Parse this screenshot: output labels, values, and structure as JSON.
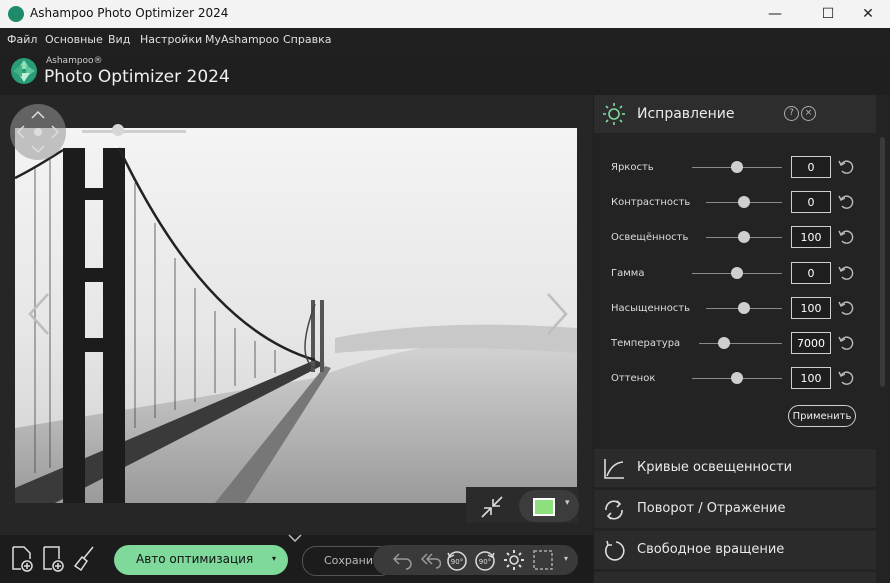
{
  "window": {
    "title": "Ashampoo Photo Optimizer 2024",
    "min": "—",
    "max": "☐",
    "close": "✕"
  },
  "menu": [
    "Файл",
    "Основные",
    "Вид",
    "Настройки",
    "MyAshampoo",
    "Справка"
  ],
  "brand": {
    "small": "Ashampoo®",
    "name": "Photo Optimizer 2024"
  },
  "panel": {
    "title": "Исправление",
    "help": "?",
    "close": "×",
    "sliders": [
      {
        "label": "Яркость",
        "value": "0",
        "level": 0.5
      },
      {
        "label": "Контрастность",
        "value": "0",
        "level": 0.5
      },
      {
        "label": "Освещённость",
        "value": "100",
        "level": 0.5
      },
      {
        "label": "Гамма",
        "value": "0",
        "level": 0.5
      },
      {
        "label": "Насыщенность",
        "value": "100",
        "level": 0.5
      },
      {
        "label": "Температура",
        "value": "7000",
        "level": 0.3
      },
      {
        "label": "Оттенок",
        "value": "100",
        "level": 0.5
      }
    ],
    "apply": "Применить",
    "sections": [
      "Кривые освещенности",
      "Поворот / Отражение",
      "Свободное вращение"
    ]
  },
  "toolbar": {
    "auto": "Авто оптимизация",
    "save": "Сохранить",
    "dropdown": "▾",
    "accent": "#7ed99b"
  },
  "viewer": {
    "zoom_level": 0.35
  }
}
